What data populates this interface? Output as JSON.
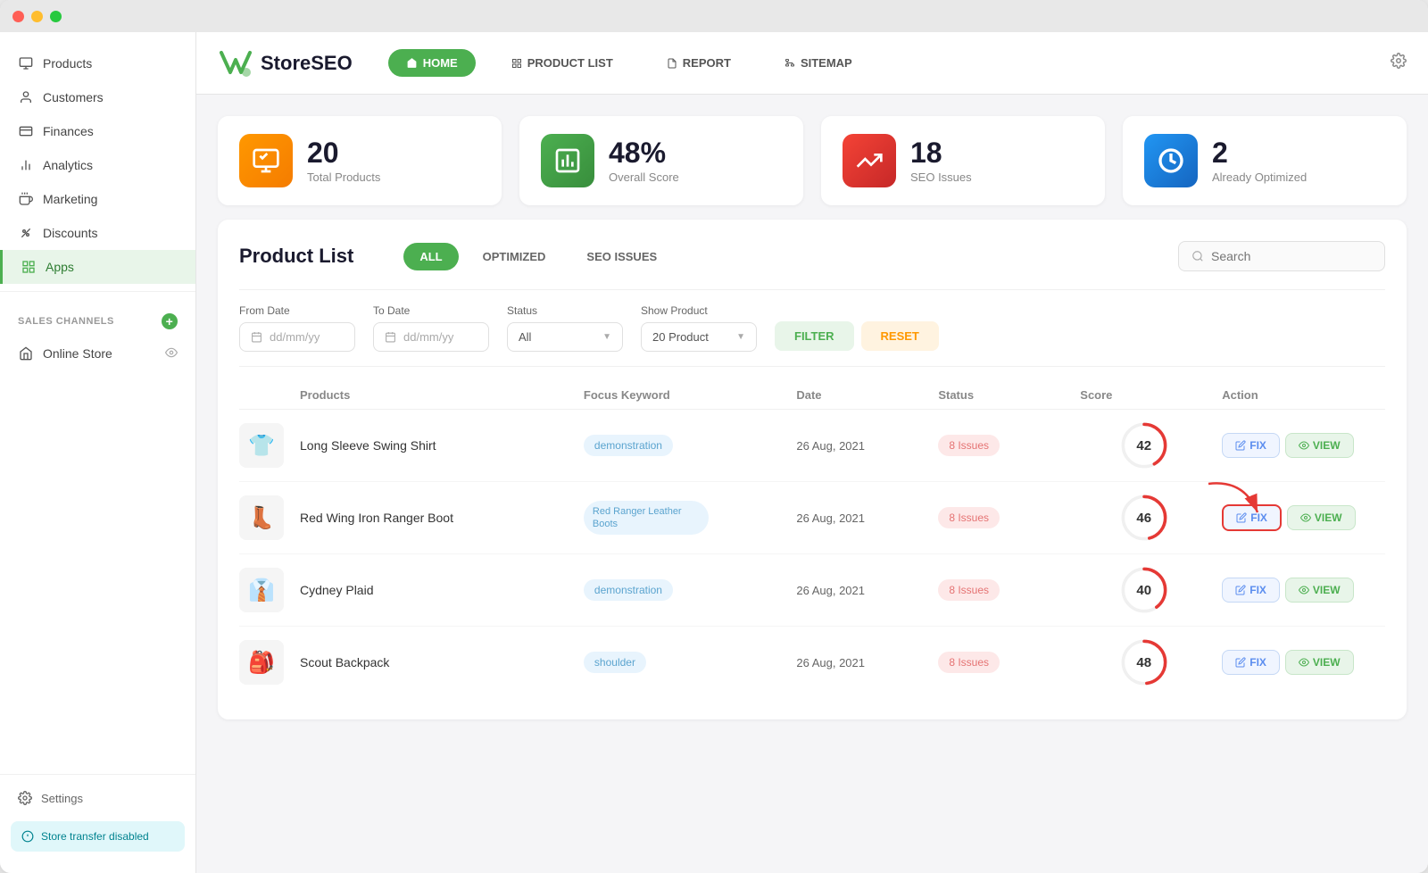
{
  "window": {
    "title": "StoreSEO"
  },
  "sidebar": {
    "items": [
      {
        "label": "Products",
        "icon": "📦",
        "active": false
      },
      {
        "label": "Customers",
        "icon": "👤",
        "active": false
      },
      {
        "label": "Finances",
        "icon": "📊",
        "active": false
      },
      {
        "label": "Analytics",
        "icon": "📈",
        "active": false
      },
      {
        "label": "Marketing",
        "icon": "📢",
        "active": false
      },
      {
        "label": "Discounts",
        "icon": "🏷️",
        "active": false
      },
      {
        "label": "Apps",
        "icon": "🟩",
        "active": true
      }
    ],
    "sales_channels_label": "SALES CHANNELS",
    "online_store_label": "Online Store",
    "settings_label": "Settings",
    "store_transfer_label": "Store transfer disabled"
  },
  "topnav": {
    "logo_text": "StoreSEO",
    "nav_items": [
      {
        "label": "HOME",
        "active": true
      },
      {
        "label": "PRODUCT LIST",
        "active": false
      },
      {
        "label": "REPORT",
        "active": false
      },
      {
        "label": "SITEMAP",
        "active": false
      }
    ]
  },
  "stats": [
    {
      "number": "20",
      "label": "Total Products",
      "icon_type": "orange"
    },
    {
      "number": "48%",
      "label": "Overall Score",
      "icon_type": "green"
    },
    {
      "number": "18",
      "label": "SEO Issues",
      "icon_type": "red"
    },
    {
      "number": "2",
      "label": "Already Optimized",
      "icon_type": "blue"
    }
  ],
  "product_list": {
    "title": "Product List",
    "tabs": [
      "ALL",
      "OPTIMIZED",
      "SEO ISSUES"
    ],
    "active_tab": "ALL",
    "search_placeholder": "Search",
    "filters": {
      "from_date_label": "From Date",
      "to_date_label": "To Date",
      "status_label": "Status",
      "show_product_label": "Show Product",
      "from_date_placeholder": "dd/mm/yy",
      "to_date_placeholder": "dd/mm/yy",
      "status_value": "All",
      "show_product_value": "20 Product",
      "filter_btn": "FILTER",
      "reset_btn": "RESET"
    },
    "table_headers": [
      "",
      "Products",
      "Focus Keyword",
      "Date",
      "Status",
      "Score",
      "Action"
    ],
    "rows": [
      {
        "img": "👕",
        "name": "Long Sleeve Swing Shirt",
        "keyword": "demonstration",
        "date": "26 Aug, 2021",
        "status": "8 Issues",
        "score": 42,
        "score_max": 100,
        "highlighted": false
      },
      {
        "img": "👢",
        "name": "Red Wing Iron Ranger Boot",
        "keyword": "Red Ranger Leather Boots",
        "date": "26 Aug, 2021",
        "status": "8 Issues",
        "score": 46,
        "score_max": 100,
        "highlighted": true
      },
      {
        "img": "👔",
        "name": "Cydney Plaid",
        "keyword": "demonstration",
        "date": "26 Aug, 2021",
        "status": "8 Issues",
        "score": 40,
        "score_max": 100,
        "highlighted": false
      },
      {
        "img": "🎒",
        "name": "Scout Backpack",
        "keyword": "shoulder",
        "date": "26 Aug, 2021",
        "status": "8 Issues",
        "score": 48,
        "score_max": 100,
        "highlighted": false
      }
    ]
  },
  "colors": {
    "accent_green": "#4caf50",
    "accent_orange": "#ff9800",
    "accent_red": "#f44336",
    "accent_blue": "#2196f3",
    "score_arc": "#e53935",
    "score_bg": "#f5f5f5"
  }
}
